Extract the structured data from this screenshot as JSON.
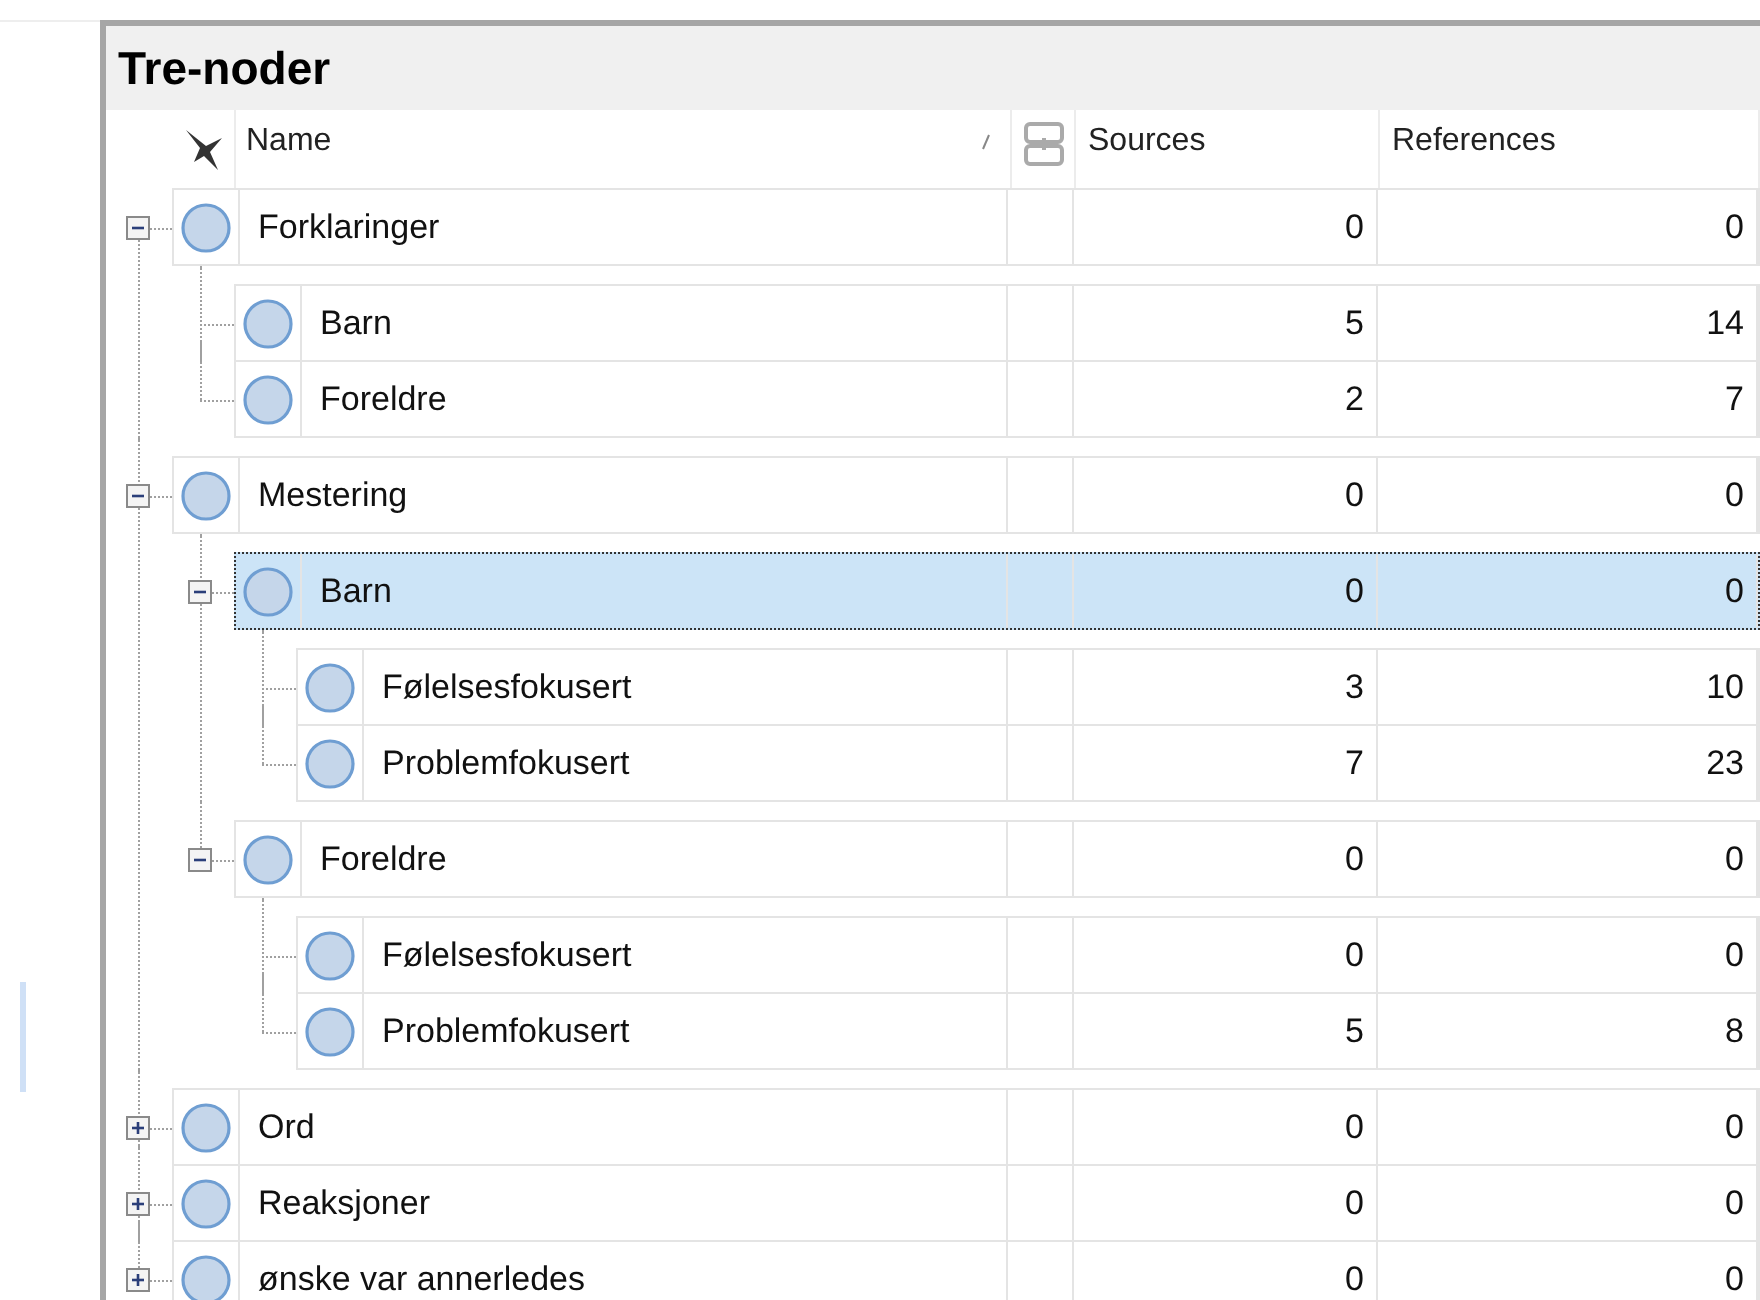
{
  "panel": {
    "title": "Tre-noder"
  },
  "columns": {
    "name": "Name",
    "sources": "Sources",
    "references": "References"
  },
  "nodes": [
    {
      "name": "Forklaringer",
      "sources": "0",
      "references": "0",
      "expanded": true,
      "selected": false,
      "children": [
        {
          "name": "Barn",
          "sources": "5",
          "references": "14",
          "selected": false
        },
        {
          "name": "Foreldre",
          "sources": "2",
          "references": "7",
          "selected": false
        }
      ]
    },
    {
      "name": "Mestering",
      "sources": "0",
      "references": "0",
      "expanded": true,
      "selected": false,
      "children": [
        {
          "name": "Barn",
          "sources": "0",
          "references": "0",
          "expanded": true,
          "selected": true,
          "children": [
            {
              "name": "Følelsesfokusert",
              "sources": "3",
              "references": "10",
              "selected": false
            },
            {
              "name": "Problemfokusert",
              "sources": "7",
              "references": "23",
              "selected": false
            }
          ]
        },
        {
          "name": "Foreldre",
          "sources": "0",
          "references": "0",
          "expanded": true,
          "selected": false,
          "children": [
            {
              "name": "Følelsesfokusert",
              "sources": "0",
              "references": "0",
              "selected": false
            },
            {
              "name": "Problemfokusert",
              "sources": "5",
              "references": "8",
              "selected": false
            }
          ]
        }
      ]
    },
    {
      "name": "Ord",
      "sources": "0",
      "references": "0",
      "expanded": false,
      "selected": false
    },
    {
      "name": "Reaksjoner",
      "sources": "0",
      "references": "0",
      "expanded": false,
      "selected": false
    },
    {
      "name": "ønske var annerledes",
      "sources": "0",
      "references": "0",
      "expanded": false,
      "selected": false
    }
  ]
}
